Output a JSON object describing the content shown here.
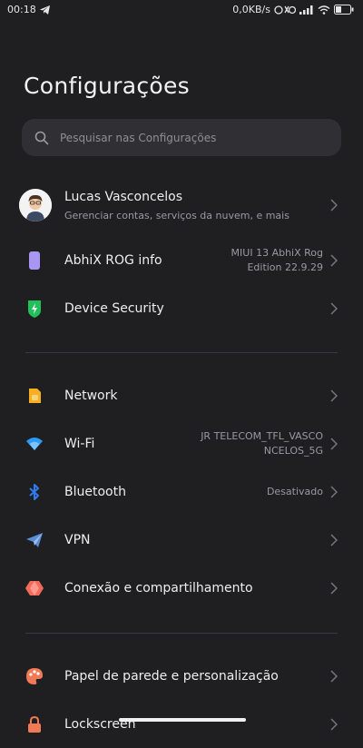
{
  "status": {
    "time": "00:18",
    "net_speed": "0,0KB/s",
    "icons": [
      "telegram-icon",
      "alarm-sync-icon",
      "signal-icon",
      "wifi-icon",
      "battery-icon"
    ]
  },
  "title": "Configurações",
  "search": {
    "placeholder": "Pesquisar nas Configurações"
  },
  "profile": {
    "name": "Lucas Vasconcelos",
    "subtitle": "Gerenciar contas, serviços da nuvem, e mais"
  },
  "items": [
    {
      "label": "AbhiX ROG info",
      "value_line1": "MIUI 13 AbhiX Rog",
      "value_line2": "Edition  22.9.29",
      "icon": "phone-info-icon",
      "color": "#a995f2"
    },
    {
      "label": "Device Security",
      "value_line1": "",
      "value_line2": "",
      "icon": "shield-icon",
      "color": "#21c15a"
    },
    {
      "label": "Network",
      "value_line1": "",
      "value_line2": "",
      "icon": "sim-card-icon",
      "color": "#f4b020"
    },
    {
      "label": "Wi-Fi",
      "value_line1": "JR TELECOM_TFL_VASCO",
      "value_line2": "NCELOS_5G",
      "icon": "wifi-icon",
      "color": "#2b9bf6"
    },
    {
      "label": "Bluetooth",
      "value_line1": "Desativado",
      "value_line2": "",
      "icon": "bluetooth-icon",
      "color": "#2f7cf0"
    },
    {
      "label": "VPN",
      "value_line1": "",
      "value_line2": "",
      "icon": "send-icon",
      "color": "#5a8fd8"
    },
    {
      "label": "Conexão e compartilhamento",
      "value_line1": "",
      "value_line2": "",
      "icon": "share-hexagon-icon",
      "color": "#f26a5a"
    },
    {
      "label": "Papel de parede e personalização",
      "value_line1": "",
      "value_line2": "",
      "icon": "palette-icon",
      "color": "#f07a55"
    },
    {
      "label": "Lockscreen",
      "value_line1": "",
      "value_line2": "",
      "icon": "lock-icon",
      "color": "#f07a55"
    }
  ]
}
